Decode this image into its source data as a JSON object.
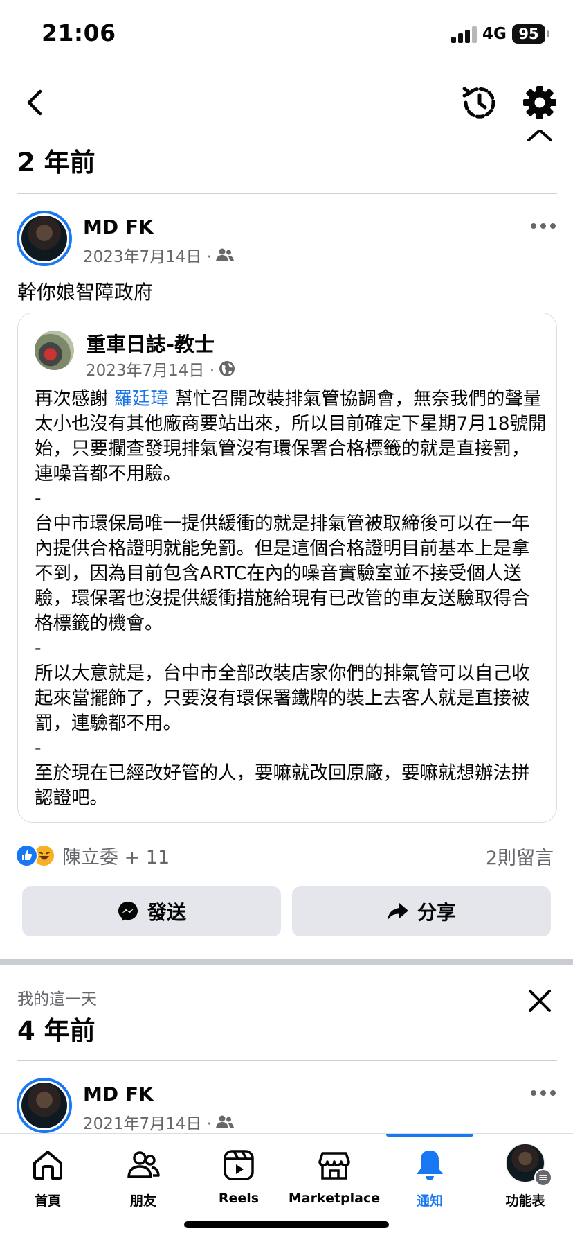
{
  "status_bar": {
    "time": "21:06",
    "network": "4G",
    "battery": "95"
  },
  "sections": [
    {
      "title": "2 年前"
    },
    {
      "label": "我的這一天",
      "title": "4 年前"
    }
  ],
  "post1": {
    "author": "MD FK",
    "date": "2023年7月14日 ·",
    "audience_icon": "friends-icon",
    "text": "幹你娘智障政府",
    "shared": {
      "author": "重車日誌-教士",
      "date": "2023年7月14日 ·",
      "audience_icon": "globe-icon",
      "body_before": "再次感謝 ",
      "mention": "羅廷瑋",
      "body_after": " 幫忙召開改裝排氣管協調會，無奈我們的聲量太小也沒有其他廠商要站出來，所以目前確定下星期7月18號開始，只要攔查發現排氣管沒有環保署合格標籤的就是直接罰，連噪音都不用驗。\n-\n台中市環保局唯一提供緩衝的就是排氣管被取締後可以在一年內提供合格證明就能免罰。但是這個合格證明目前基本上是拿不到，因為目前包含ARTC在內的噪音實驗室並不接受個人送驗，環保署也沒提供緩衝措施給現有已改管的車友送驗取得合格標籤的機會。\n-\n所以大意就是，台中市全部改裝店家你們的排氣管可以自己收起來當擺飾了，只要沒有環保署鐵牌的裝上去客人就是直接被罰，連驗都不用。\n-\n至於現在已經改好管的人，要嘛就改回原廠，要嘛就想辦法拼認證吧。"
    },
    "reactions": {
      "icons": [
        "like-icon",
        "haha-icon"
      ],
      "text": "陳立委 + 11"
    },
    "comments": "2則留言",
    "actions": {
      "send": "發送",
      "share": "分享"
    }
  },
  "post2": {
    "author": "MD FK",
    "date": "2021年7月14日 ·",
    "audience_icon": "friends-icon"
  },
  "bottom_nav": [
    {
      "label": "首頁",
      "icon": "home-icon"
    },
    {
      "label": "朋友",
      "icon": "friends-icon"
    },
    {
      "label": "Reels",
      "icon": "reels-icon"
    },
    {
      "label": "Marketplace",
      "icon": "marketplace-icon"
    },
    {
      "label": "通知",
      "icon": "bell-icon",
      "active": true
    },
    {
      "label": "功能表",
      "icon": "menu-avatar"
    }
  ],
  "colors": {
    "accent": "#1877f2",
    "secondary_text": "#65676b",
    "button_bg": "#e4e6eb"
  }
}
